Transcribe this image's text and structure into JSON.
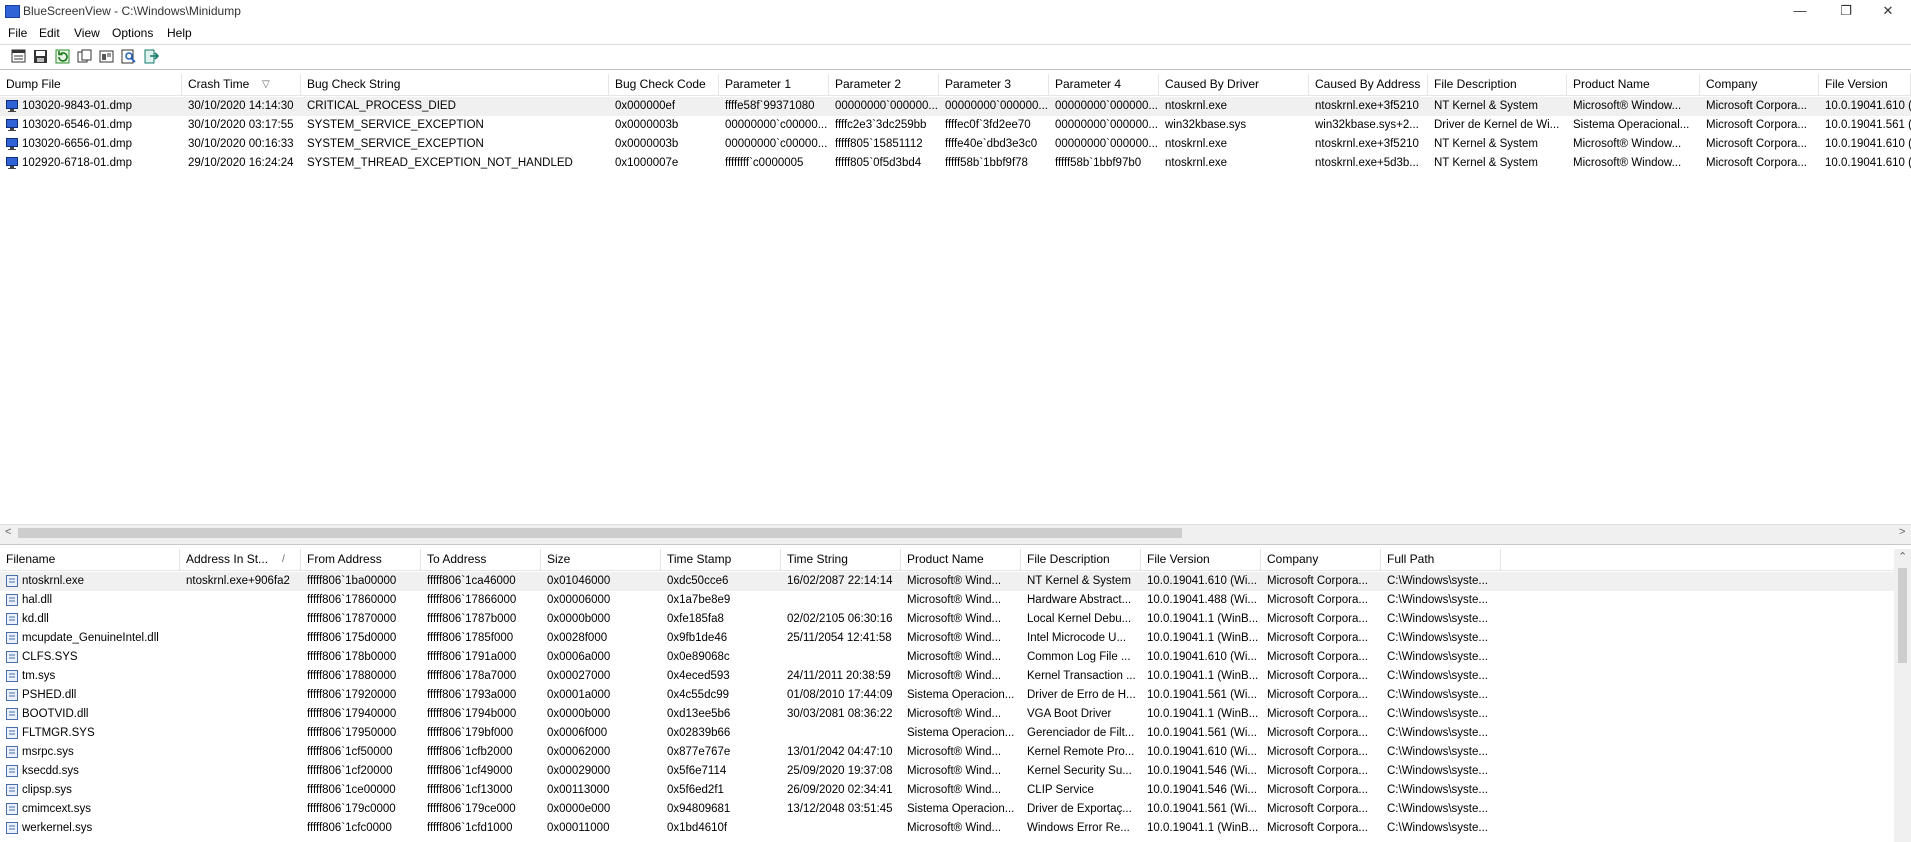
{
  "window": {
    "title": "BlueScreenView  -  C:\\Windows\\Minidump",
    "minimize": "—",
    "maximize": "❐",
    "close": "✕"
  },
  "menu": [
    "File",
    "Edit",
    "View",
    "Options",
    "Help"
  ],
  "toolbar": [
    {
      "name": "properties-icon"
    },
    {
      "name": "save-icon"
    },
    {
      "name": "refresh-icon"
    },
    {
      "name": "copy-icon"
    },
    {
      "name": "options-icon"
    },
    {
      "name": "find-icon"
    },
    {
      "name": "exit-icon"
    }
  ],
  "dumps": {
    "columns": [
      "Dump File",
      "Crash Time",
      "Bug Check String",
      "Bug Check Code",
      "Parameter 1",
      "Parameter 2",
      "Parameter 3",
      "Parameter 4",
      "Caused By Driver",
      "Caused By Address",
      "File Description",
      "Product Name",
      "Company",
      "File Version"
    ],
    "sort_indicator": "▽",
    "rows": [
      [
        "103020-9843-01.dmp",
        "30/10/2020 14:14:30",
        "CRITICAL_PROCESS_DIED",
        "0x000000ef",
        "ffffe58f`99371080",
        "00000000`000000...",
        "00000000`000000...",
        "00000000`000000...",
        "ntoskrnl.exe",
        "ntoskrnl.exe+3f5210",
        "NT Kernel & System",
        "Microsoft® Window...",
        "Microsoft Corpora...",
        "10.0.19041.610 (W"
      ],
      [
        "103020-6546-01.dmp",
        "30/10/2020 03:17:55",
        "SYSTEM_SERVICE_EXCEPTION",
        "0x0000003b",
        "00000000`c00000...",
        "ffffc2e3`3dc259bb",
        "ffffec0f`3fd2ee70",
        "00000000`000000...",
        "win32kbase.sys",
        "win32kbase.sys+2...",
        "Driver de Kernel de Wi...",
        "Sistema Operacional...",
        "Microsoft Corpora...",
        "10.0.19041.561 (W"
      ],
      [
        "103020-6656-01.dmp",
        "30/10/2020 00:16:33",
        "SYSTEM_SERVICE_EXCEPTION",
        "0x0000003b",
        "00000000`c00000...",
        "fffff805`15851112",
        "ffffe40e`dbd3e3c0",
        "00000000`000000...",
        "ntoskrnl.exe",
        "ntoskrnl.exe+3f5210",
        "NT Kernel & System",
        "Microsoft® Window...",
        "Microsoft Corpora...",
        "10.0.19041.610 (W"
      ],
      [
        "102920-6718-01.dmp",
        "29/10/2020 16:24:24",
        "SYSTEM_THREAD_EXCEPTION_NOT_HANDLED",
        "0x1000007e",
        "ffffffff`c0000005",
        "fffff805`0f5d3bd4",
        "fffff58b`1bbf9f78",
        "fffff58b`1bbf97b0",
        "ntoskrnl.exe",
        "ntoskrnl.exe+5d3b...",
        "NT Kernel & System",
        "Microsoft® Window...",
        "Microsoft Corpora...",
        "10.0.19041.610 (W"
      ]
    ]
  },
  "modules": {
    "columns": [
      "Filename",
      "Address In St...",
      "From Address",
      "To Address",
      "Size",
      "Time Stamp",
      "Time String",
      "Product Name",
      "File Description",
      "File Version",
      "Company",
      "Full Path"
    ],
    "sort_indicator": "/",
    "rows": [
      [
        "ntoskrnl.exe",
        "ntoskrnl.exe+906fa2",
        "fffff806`1ba00000",
        "fffff806`1ca46000",
        "0x01046000",
        "0xdc50cce6",
        "16/02/2087 22:14:14",
        "Microsoft® Wind...",
        "NT Kernel & System",
        "10.0.19041.610 (Wi...",
        "Microsoft Corpora...",
        "C:\\Windows\\syste..."
      ],
      [
        "hal.dll",
        "",
        "fffff806`17860000",
        "fffff806`17866000",
        "0x00006000",
        "0x1a7be8e9",
        "",
        "Microsoft® Wind...",
        "Hardware Abstract...",
        "10.0.19041.488 (Wi...",
        "Microsoft Corpora...",
        "C:\\Windows\\syste..."
      ],
      [
        "kd.dll",
        "",
        "fffff806`17870000",
        "fffff806`1787b000",
        "0x0000b000",
        "0xfe185fa8",
        "02/02/2105 06:30:16",
        "Microsoft® Wind...",
        "Local Kernel Debu...",
        "10.0.19041.1 (WinB...",
        "Microsoft Corpora...",
        "C:\\Windows\\syste..."
      ],
      [
        "mcupdate_GenuineIntel.dll",
        "",
        "fffff806`175d0000",
        "fffff806`1785f000",
        "0x0028f000",
        "0x9fb1de46",
        "25/11/2054 12:41:58",
        "Microsoft® Wind...",
        "Intel Microcode U...",
        "10.0.19041.1 (WinB...",
        "Microsoft Corpora...",
        "C:\\Windows\\syste..."
      ],
      [
        "CLFS.SYS",
        "",
        "fffff806`178b0000",
        "fffff806`1791a000",
        "0x0006a000",
        "0x0e89068c",
        "",
        "Microsoft® Wind...",
        "Common Log File ...",
        "10.0.19041.610 (Wi...",
        "Microsoft Corpora...",
        "C:\\Windows\\syste..."
      ],
      [
        "tm.sys",
        "",
        "fffff806`17880000",
        "fffff806`178a7000",
        "0x00027000",
        "0x4eced593",
        "24/11/2011 20:38:59",
        "Microsoft® Wind...",
        "Kernel Transaction ...",
        "10.0.19041.1 (WinB...",
        "Microsoft Corpora...",
        "C:\\Windows\\syste..."
      ],
      [
        "PSHED.dll",
        "",
        "fffff806`17920000",
        "fffff806`1793a000",
        "0x0001a000",
        "0x4c55dc99",
        "01/08/2010 17:44:09",
        "Sistema Operacion...",
        "Driver de Erro de H...",
        "10.0.19041.561 (Wi...",
        "Microsoft Corpora...",
        "C:\\Windows\\syste..."
      ],
      [
        "BOOTVID.dll",
        "",
        "fffff806`17940000",
        "fffff806`1794b000",
        "0x0000b000",
        "0xd13ee5b6",
        "30/03/2081 08:36:22",
        "Microsoft® Wind...",
        "VGA Boot Driver",
        "10.0.19041.1 (WinB...",
        "Microsoft Corpora...",
        "C:\\Windows\\syste..."
      ],
      [
        "FLTMGR.SYS",
        "",
        "fffff806`17950000",
        "fffff806`179bf000",
        "0x0006f000",
        "0x02839b66",
        "",
        "Sistema Operacion...",
        "Gerenciador de Filt...",
        "10.0.19041.561 (Wi...",
        "Microsoft Corpora...",
        "C:\\Windows\\syste..."
      ],
      [
        "msrpc.sys",
        "",
        "fffff806`1cf50000",
        "fffff806`1cfb2000",
        "0x00062000",
        "0x877e767e",
        "13/01/2042 04:47:10",
        "Microsoft® Wind...",
        "Kernel Remote Pro...",
        "10.0.19041.610 (Wi...",
        "Microsoft Corpora...",
        "C:\\Windows\\syste..."
      ],
      [
        "ksecdd.sys",
        "",
        "fffff806`1cf20000",
        "fffff806`1cf49000",
        "0x00029000",
        "0x5f6e7114",
        "25/09/2020 19:37:08",
        "Microsoft® Wind...",
        "Kernel Security Su...",
        "10.0.19041.546 (Wi...",
        "Microsoft Corpora...",
        "C:\\Windows\\syste..."
      ],
      [
        "clipsp.sys",
        "",
        "fffff806`1ce00000",
        "fffff806`1cf13000",
        "0x00113000",
        "0x5f6ed2f1",
        "26/09/2020 02:34:41",
        "Microsoft® Wind...",
        "CLIP Service",
        "10.0.19041.546 (Wi...",
        "Microsoft Corpora...",
        "C:\\Windows\\syste..."
      ],
      [
        "cmimcext.sys",
        "",
        "fffff806`179c0000",
        "fffff806`179ce000",
        "0x0000e000",
        "0x94809681",
        "13/12/2048 03:51:45",
        "Sistema Operacion...",
        "Driver de Exportaç...",
        "10.0.19041.561 (Wi...",
        "Microsoft Corpora...",
        "C:\\Windows\\syste..."
      ],
      [
        "werkernel.sys",
        "",
        "fffff806`1cfc0000",
        "fffff806`1cfd1000",
        "0x00011000",
        "0x1bd4610f",
        "",
        "Microsoft® Wind...",
        "Windows Error Re...",
        "10.0.19041.1 (WinB...",
        "Microsoft Corpora...",
        "C:\\Windows\\syste..."
      ]
    ]
  },
  "colors": {
    "selected_row": "#f0f0f0",
    "icon_blue": "#2f63d6",
    "header_border": "#e5e5e5"
  }
}
